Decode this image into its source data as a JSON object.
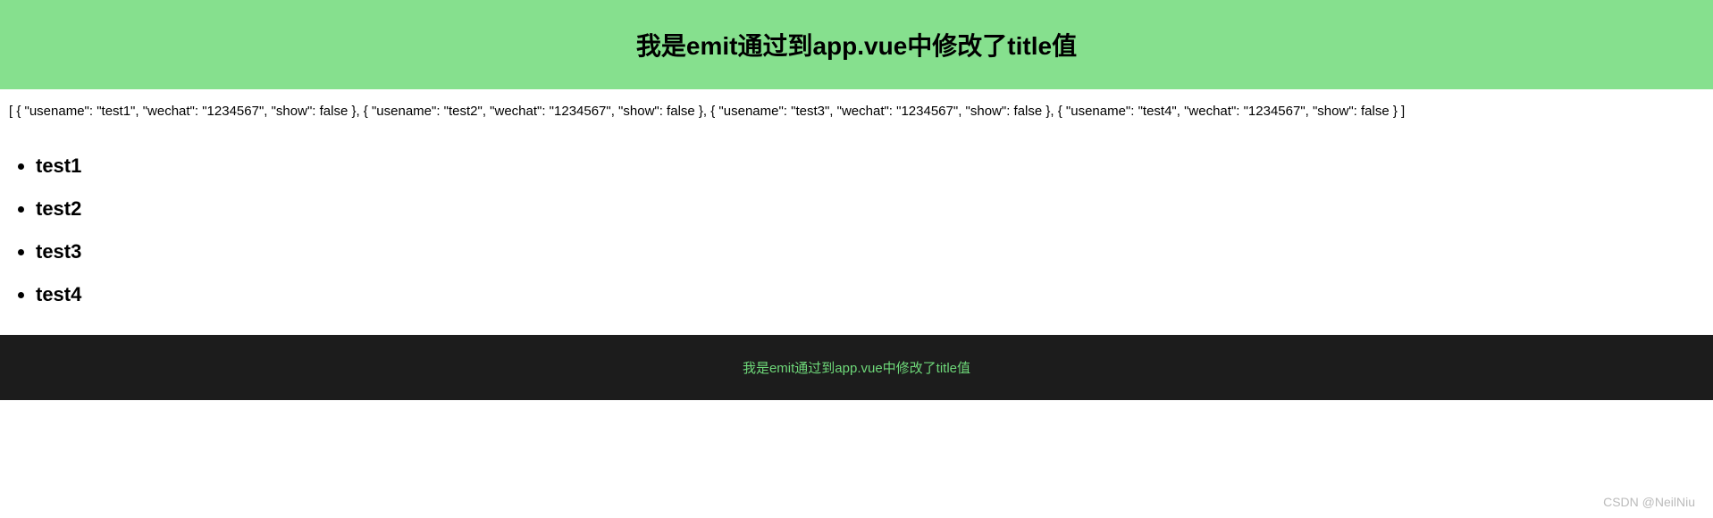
{
  "header": {
    "title": "我是emit通过到app.vue中修改了title值"
  },
  "json_dump": "[ { \"usename\": \"test1\", \"wechat\": \"1234567\", \"show\": false }, { \"usename\": \"test2\", \"wechat\": \"1234567\", \"show\": false }, { \"usename\": \"test3\", \"wechat\": \"1234567\", \"show\": false }, { \"usename\": \"test4\", \"wechat\": \"1234567\", \"show\": false } ]",
  "list": {
    "items": [
      {
        "label": "test1"
      },
      {
        "label": "test2"
      },
      {
        "label": "test3"
      },
      {
        "label": "test4"
      }
    ]
  },
  "footer": {
    "text": "我是emit通过到app.vue中修改了title值"
  },
  "watermark": "CSDN @NeilNiu",
  "colors": {
    "header_bg": "#86e08e",
    "footer_bg": "#1c1c1c",
    "footer_text": "#6ed879"
  }
}
